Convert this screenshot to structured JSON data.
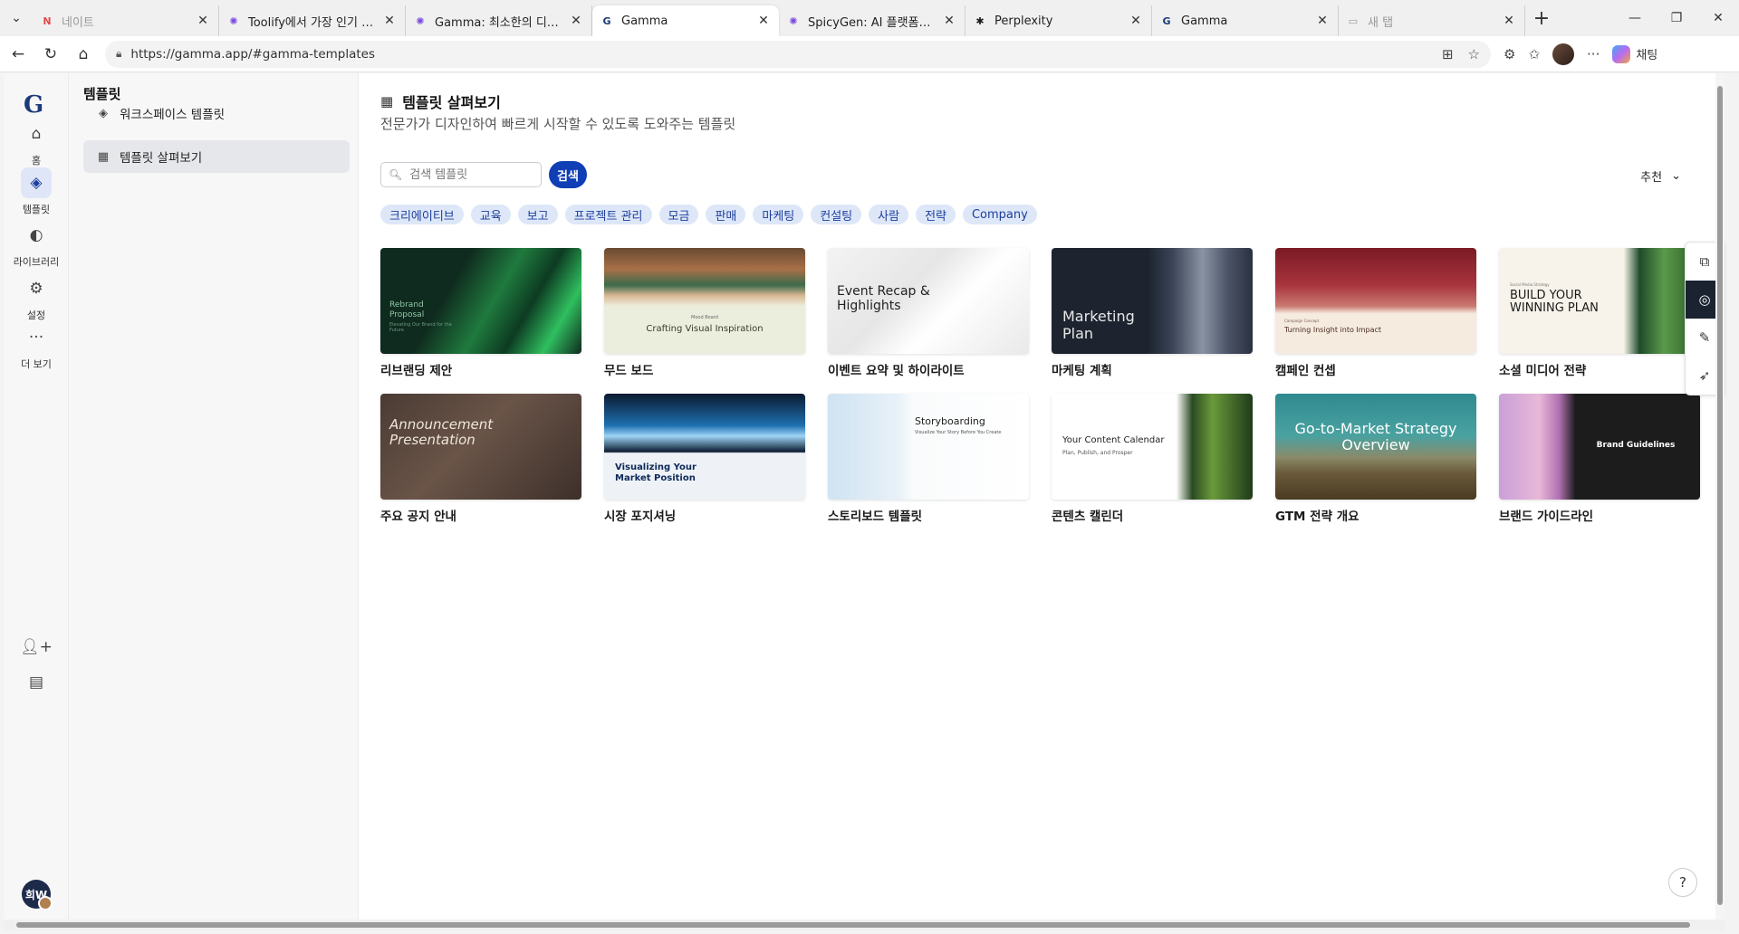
{
  "browser": {
    "tabs": [
      {
        "title": "네이트",
        "favicon": "N",
        "color": "#e34a4a",
        "state": "faded"
      },
      {
        "title": "Toolify에서 가장 인기 있는 AI",
        "favicon": "✺",
        "color": "#7b4ce0",
        "state": ""
      },
      {
        "title": "Gamma: 최소한의 디자인 노력",
        "favicon": "✺",
        "color": "#7b4ce0",
        "state": ""
      },
      {
        "title": "Gamma",
        "favicon": "G",
        "color": "#1c3a7a",
        "state": "active"
      },
      {
        "title": "SpicyGen: AI 플랫폼으로 이미",
        "favicon": "✺",
        "color": "#7b4ce0",
        "state": ""
      },
      {
        "title": "Perplexity",
        "favicon": "✱",
        "color": "#1a1a1a",
        "state": ""
      },
      {
        "title": "Gamma",
        "favicon": "G",
        "color": "#1c3a7a",
        "state": ""
      },
      {
        "title": "새 탭",
        "favicon": "▭",
        "color": "#999999",
        "state": "faded"
      }
    ],
    "url": "https://gamma.app/#gamma-templates",
    "copilot_label": "채팅"
  },
  "rail": {
    "items": [
      {
        "label": "홈",
        "icon": "home-icon",
        "glyph": "⌂"
      },
      {
        "label": "템플릿",
        "icon": "layers-icon",
        "glyph": "◈"
      },
      {
        "label": "라이브러리",
        "icon": "palette-icon",
        "glyph": "◐"
      },
      {
        "label": "설정",
        "icon": "gear-icon",
        "glyph": "⚙"
      },
      {
        "label": "더 보기",
        "icon": "more-icon",
        "glyph": "···"
      }
    ],
    "avatar_initials": "희W"
  },
  "subnav": {
    "title": "템플릿",
    "workspace_templates": "워크스페이스 템플릿",
    "browse_templates": "템플릿 살펴보기"
  },
  "main": {
    "title": "템플릿 살펴보기",
    "description": "전문가가 디자인하여 빠르게 시작할 수 있도록 도와주는 템플릿",
    "search_placeholder": "검색 템플릿",
    "search_button": "검색",
    "sort_label": "추천",
    "categories": [
      "크리에이티브",
      "교육",
      "보고",
      "프로젝트 관리",
      "모금",
      "판매",
      "마케팅",
      "컨설팅",
      "사람",
      "전략",
      "Company"
    ],
    "templates": [
      {
        "label": "리브랜딩 제안",
        "thumb_text": "Rebrand Proposal",
        "thumb_sub": "Elevating Our Brand for the Future"
      },
      {
        "label": "무드 보드",
        "thumb_text": "Crafting Visual Inspiration",
        "thumb_sub": "Mood Board"
      },
      {
        "label": "이벤트 요약 및 하이라이트",
        "thumb_text": "Event Recap & Highlights",
        "thumb_sub": ""
      },
      {
        "label": "마케팅 계획",
        "thumb_text": "Marketing Plan",
        "thumb_sub": ""
      },
      {
        "label": "캠페인 컨셉",
        "thumb_text": "Turning Insight into Impact",
        "thumb_sub": "Campaign Concept"
      },
      {
        "label": "소셜 미디어 전략",
        "thumb_text": "BUILD YOUR WINNING PLAN",
        "thumb_sub": "Social Media Strategy"
      },
      {
        "label": "주요 공지 안내",
        "thumb_text": "Announcement Presentation",
        "thumb_sub": ""
      },
      {
        "label": "시장 포지셔닝",
        "thumb_text": "Visualizing Your Market Position",
        "thumb_sub": ""
      },
      {
        "label": "스토리보드 템플릿",
        "thumb_text": "Storyboarding",
        "thumb_sub": "Visualize Your Story Before You Create"
      },
      {
        "label": "콘텐츠 캘린더",
        "thumb_text": "Your Content Calendar",
        "thumb_sub": "Plan, Publish, and Prosper"
      },
      {
        "label": "GTM 전략 개요",
        "thumb_text": "Go-to-Market Strategy Overview",
        "thumb_sub": ""
      },
      {
        "label": "브랜드 가이드라인",
        "thumb_text": "Brand Guidelines",
        "thumb_sub": ""
      }
    ]
  },
  "colors": {
    "accent": "#0f3eb5",
    "chip_bg": "#dde7f8",
    "chip_text": "#1d3f9c"
  }
}
